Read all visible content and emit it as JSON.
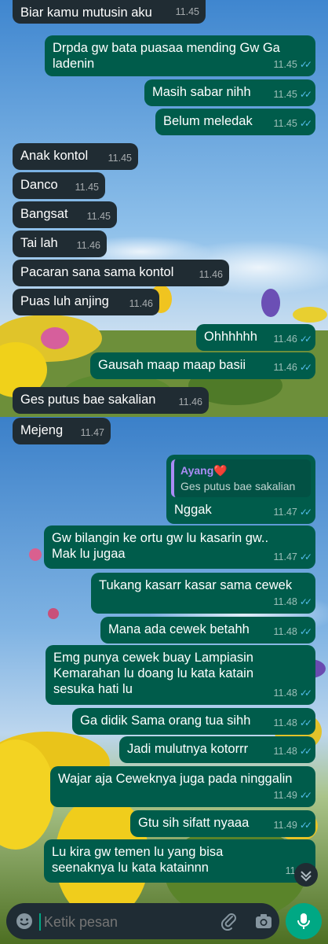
{
  "colors": {
    "incoming_bubble": "#202c33",
    "outgoing_bubble": "#005c4b",
    "read_ticks": "#53bdeb",
    "quote_name": "#a98cf5",
    "mic_button": "#00a884",
    "input_bar": "#1f2c34"
  },
  "messages_top": [
    {
      "dir": "in",
      "text": "Biar kamu mutusin aku",
      "time": "11.45"
    },
    {
      "dir": "out",
      "text": "Drpda gw bata puasaa mending Gw Ga ladenin",
      "time": "11.45"
    },
    {
      "dir": "out",
      "text": "Masih sabar nihh",
      "time": "11.45"
    },
    {
      "dir": "out",
      "text": "Belum meledak",
      "time": "11.45"
    },
    {
      "dir": "in",
      "text": "Anak kontol",
      "time": "11.45"
    },
    {
      "dir": "in",
      "text": "Danco",
      "time": "11.45"
    },
    {
      "dir": "in",
      "text": "Bangsat",
      "time": "11.45"
    },
    {
      "dir": "in",
      "text": "Tai lah",
      "time": "11.46"
    },
    {
      "dir": "in",
      "text": "Pacaran sana sama kontol",
      "time": "11.46"
    },
    {
      "dir": "in",
      "text": "Puas luh anjing",
      "time": "11.46"
    },
    {
      "dir": "out",
      "text": "Ohhhhhh",
      "time": "11.46"
    },
    {
      "dir": "out",
      "text": "Gausah maap maap basii",
      "time": "11.46"
    },
    {
      "dir": "in",
      "text": "Ges putus bae sakalian",
      "time": "11.46"
    }
  ],
  "messages_bottom": [
    {
      "dir": "in",
      "text": "Mejeng",
      "time": "11.47"
    },
    {
      "dir": "out",
      "quote_name": "Ayang❤️",
      "quote_text": "Ges putus bae sakalian",
      "text": "Nggak",
      "time": "11.47"
    },
    {
      "dir": "out",
      "text": "Gw bilangin ke ortu gw lu kasarin gw.. Mak lu jugaa",
      "time": "11.47"
    },
    {
      "dir": "out",
      "text": "Tukang kasarr kasar sama cewek",
      "time": "11.48"
    },
    {
      "dir": "out",
      "text": "Mana ada cewek betahh",
      "time": "11.48"
    },
    {
      "dir": "out",
      "text": "Emg punya cewek buay Lampiasin Kemarahan lu doang lu kata katain sesuka hati lu",
      "time": "11.48"
    },
    {
      "dir": "out",
      "text": "Ga didik Sama orang tua sihh",
      "time": "11.48"
    },
    {
      "dir": "out",
      "text": "Jadi mulutnya kotorrr",
      "time": "11.48"
    },
    {
      "dir": "out",
      "text": "Wajar aja Ceweknya juga pada ninggalin",
      "time": "11.49"
    },
    {
      "dir": "out",
      "text": "Gtu sih sifatt nyaaa",
      "time": "11.49"
    },
    {
      "dir": "out",
      "text": "Lu kira gw temen lu yang bisa seenaknya lu kata katainnn",
      "time": "11.49"
    }
  ],
  "composer": {
    "placeholder": "Ketik pesan",
    "emoji_icon": "emoji-icon",
    "attach_icon": "paperclip-icon",
    "camera_icon": "camera-icon",
    "mic_icon": "microphone-icon"
  },
  "scroll_icon": "chevron-down-icon"
}
